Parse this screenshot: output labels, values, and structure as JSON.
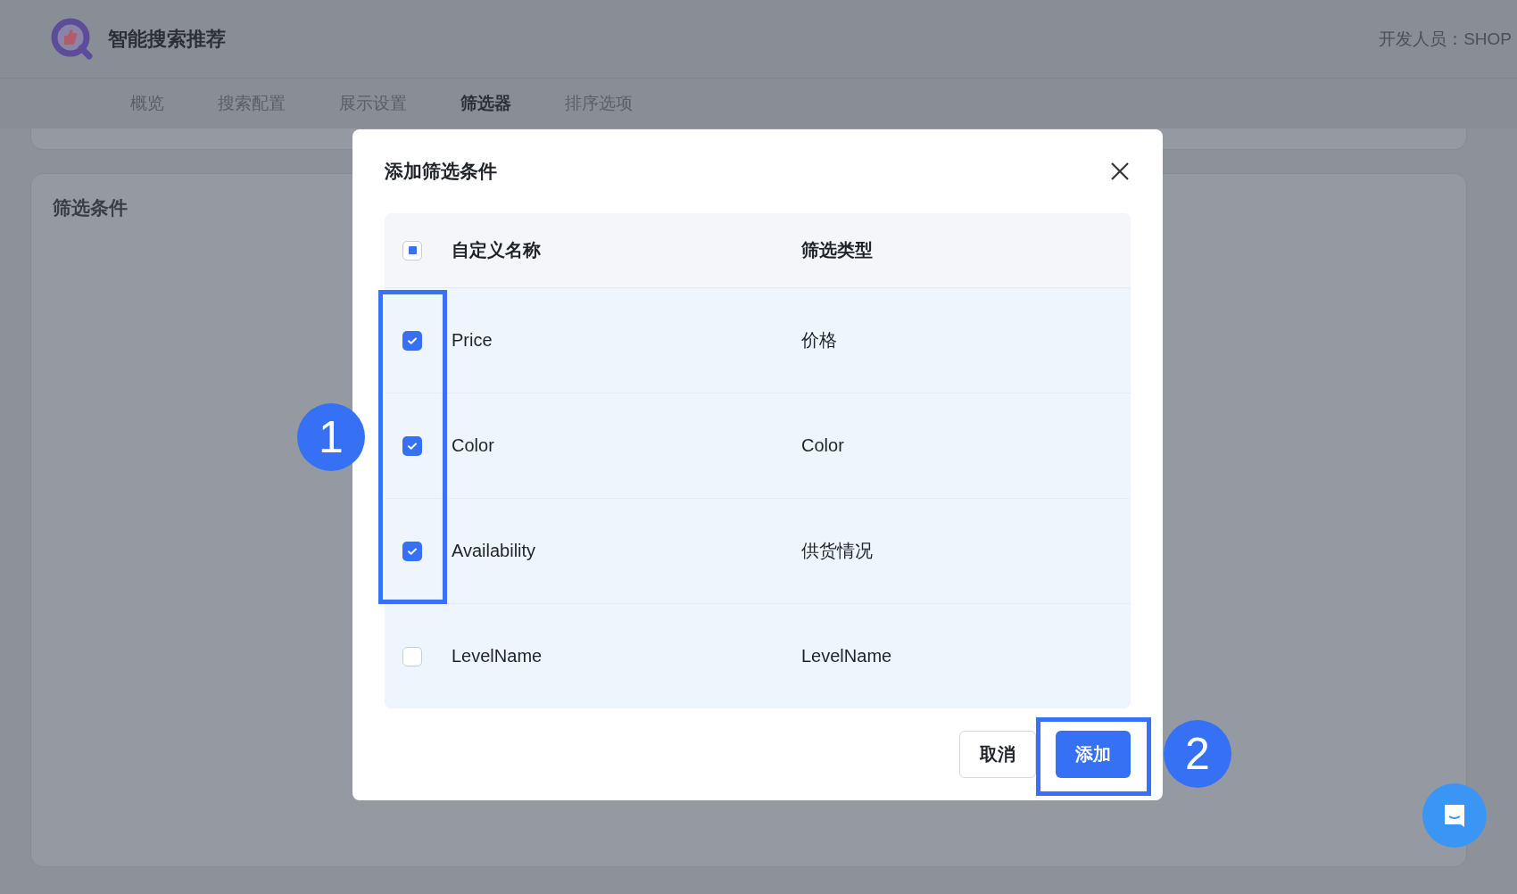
{
  "header": {
    "app_title": "智能搜索推荐",
    "developer": "开发人员：SHOP"
  },
  "nav_tabs": [
    {
      "label": "概览",
      "selected": false
    },
    {
      "label": "搜索配置",
      "selected": false
    },
    {
      "label": "展示设置",
      "selected": false
    },
    {
      "label": "筛选器",
      "selected": true
    },
    {
      "label": "排序选项",
      "selected": false
    }
  ],
  "card": {
    "title": "筛选条件"
  },
  "dialog": {
    "title": "添加筛选条件",
    "columns": [
      "自定义名称",
      "筛选类型"
    ],
    "select_all": {
      "indeterminate": true
    },
    "rows": [
      {
        "name": "Price",
        "type": "价格",
        "checked": true
      },
      {
        "name": "Color",
        "type": "Color",
        "checked": true
      },
      {
        "name": "Availability",
        "type": "供货情况",
        "checked": true
      },
      {
        "name": "LevelName",
        "type": "LevelName",
        "checked": false
      }
    ],
    "buttons": {
      "cancel": "取消",
      "confirm": "添加"
    }
  },
  "annotations": [
    {
      "number": "1"
    },
    {
      "number": "2"
    }
  ]
}
